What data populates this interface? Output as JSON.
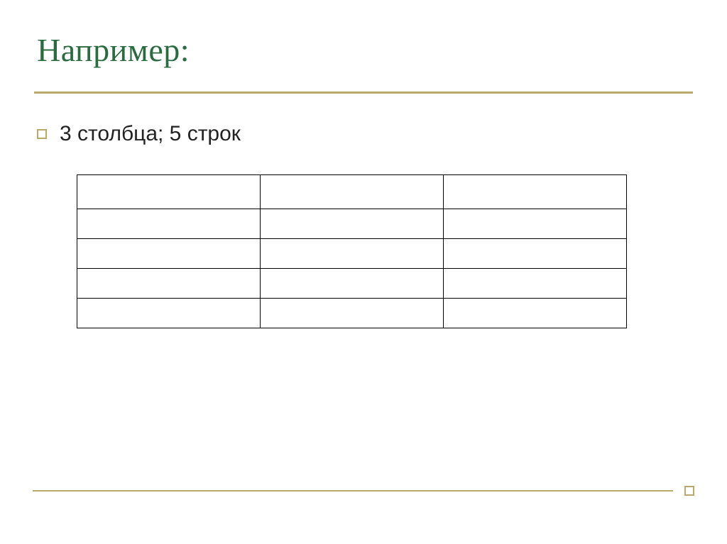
{
  "title": "Например:",
  "bullet_text": "3 столбца; 5 строк",
  "table": {
    "columns": 3,
    "rows": 5,
    "cells": [
      [
        "",
        "",
        ""
      ],
      [
        "",
        "",
        ""
      ],
      [
        "",
        "",
        ""
      ],
      [
        "",
        "",
        ""
      ],
      [
        "",
        "",
        ""
      ]
    ]
  }
}
